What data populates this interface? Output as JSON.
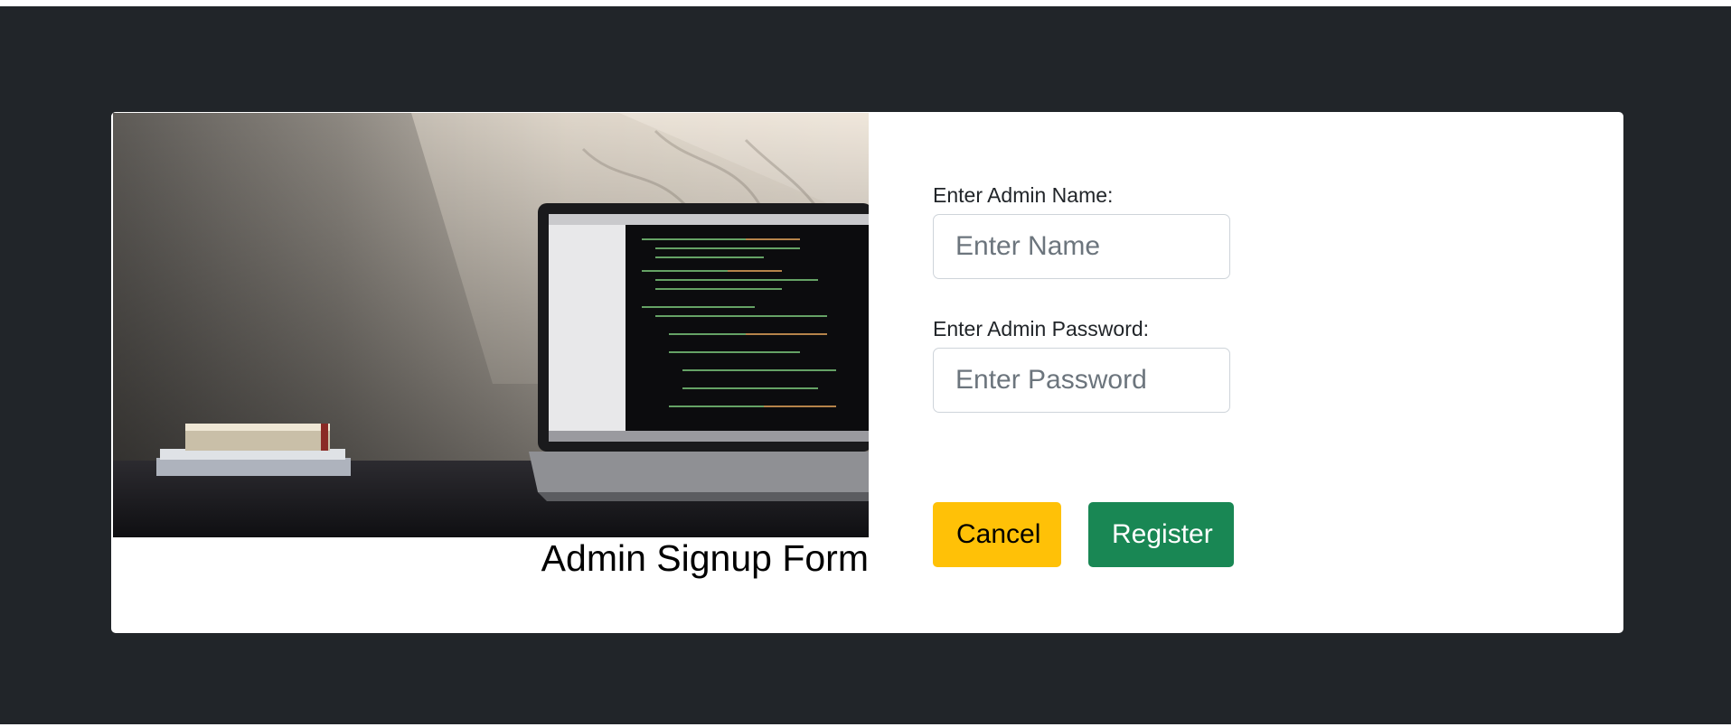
{
  "form": {
    "title": "Admin Signup Form",
    "name_label": "Enter Admin Name:",
    "name_placeholder": "Enter Name",
    "name_value": "",
    "password_label": "Enter Admin Password:",
    "password_placeholder": "Enter Password",
    "password_value": "",
    "cancel_label": "Cancel",
    "register_label": "Register"
  },
  "image": {
    "subject": "laptop with code editor on desk beside books"
  },
  "colors": {
    "page_background": "#212529",
    "card_background": "#ffffff",
    "cancel_button": "#ffc107",
    "register_button": "#198754"
  }
}
